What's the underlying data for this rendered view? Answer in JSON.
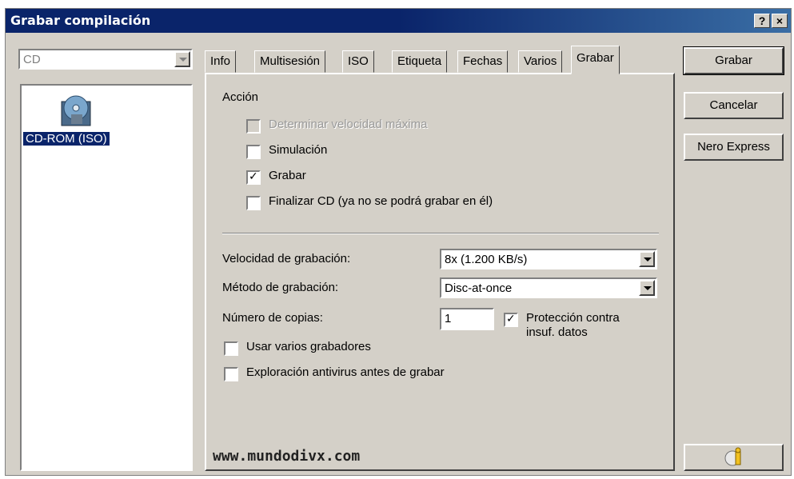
{
  "window": {
    "title": "Grabar compilación",
    "help": "?",
    "close": "×"
  },
  "media_combo": {
    "value": "CD"
  },
  "compilation_list": {
    "items": [
      {
        "label": "CD-ROM (ISO)",
        "icon": "cd-rom-icon"
      }
    ]
  },
  "tabs": [
    "Info",
    "Multisesión",
    "ISO",
    "Etiqueta",
    "Fechas",
    "Varios",
    "Grabar"
  ],
  "active_tab": "Grabar",
  "panel": {
    "action_heading": "Acción",
    "checkboxes": {
      "max_speed": {
        "label": "Determinar velocidad máxima",
        "checked": false,
        "disabled": true
      },
      "simulation": {
        "label": "Simulación",
        "checked": false
      },
      "burn": {
        "label": "Grabar",
        "checked": true
      },
      "finalize": {
        "label": "Finalizar CD (ya no se podrá grabar en él)",
        "checked": false
      }
    },
    "speed": {
      "label": "Velocidad de grabación:",
      "value": "8x (1.200 KB/s)"
    },
    "method": {
      "label": "Método de grabación:",
      "value": "Disc-at-once"
    },
    "copies": {
      "label": "Número de copias:",
      "value": "1"
    },
    "buffer_protection": {
      "label_line1": "Protección contra",
      "label_line2": "insuf. datos",
      "checked": true
    },
    "multiple_burners": {
      "label": "Usar varios grabadores",
      "checked": false
    },
    "antivirus": {
      "label": "Exploración antivirus antes de grabar",
      "checked": false
    },
    "watermark": "www.mundodivx.com"
  },
  "buttons": {
    "burn": "Grabar",
    "cancel": "Cancelar",
    "nero_express": "Nero Express"
  },
  "colors": {
    "titlebar": "#0a246a",
    "face": "#d4d0c8",
    "selection": "#0a246a"
  }
}
